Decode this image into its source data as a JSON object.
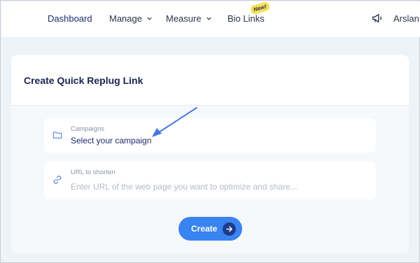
{
  "nav": {
    "dashboard": "Dashboard",
    "manage": "Manage",
    "measure": "Measure",
    "bio_links": "Bio Links",
    "new_badge": "New!",
    "user": "Arslan"
  },
  "card": {
    "title": "Create Quick Replug Link",
    "campaign": {
      "label": "Campaigns",
      "value": "Select your campaign"
    },
    "url": {
      "label": "URL to shorten",
      "placeholder": "Enter URL of the web page you want to optimize and share..."
    },
    "create_label": "Create"
  },
  "icons": {
    "campaign": "folder-icon",
    "url": "link-icon",
    "announce": "megaphone-icon",
    "create": "arrow-right-icon"
  },
  "colors": {
    "accent": "#3a84f2",
    "annotation": "#4a78e0",
    "title": "#1b2352"
  }
}
